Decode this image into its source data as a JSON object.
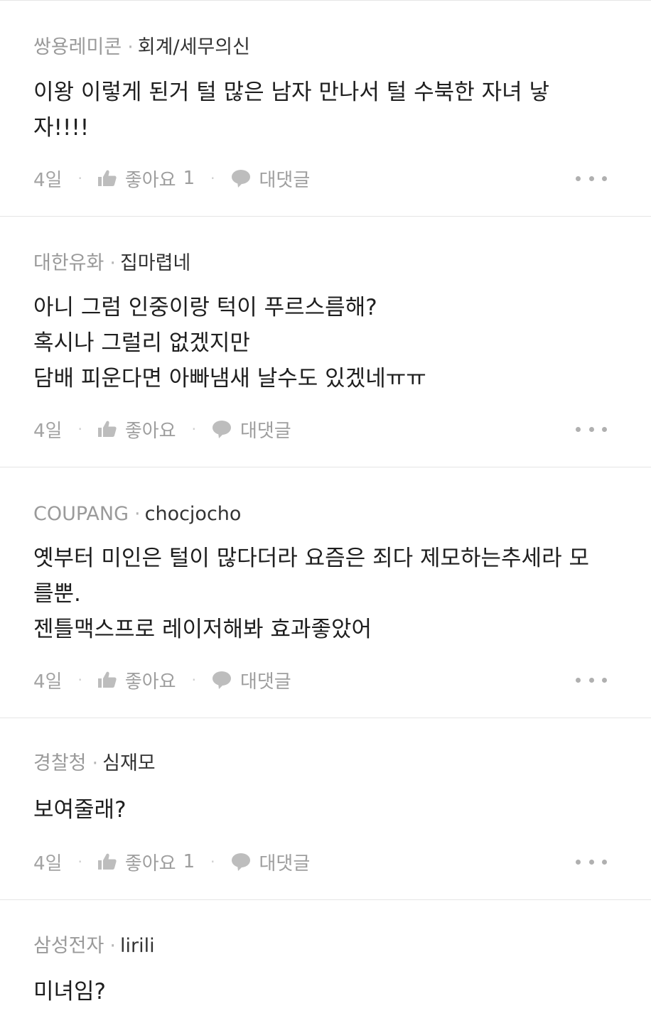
{
  "comments": [
    {
      "company": "쌍용레미콘",
      "nickname": "회계/세무의신",
      "lines": [
        "이왕 이렇게 된거 털 많은 남자 만나서 털 수북한 자녀 낳",
        "자!!!!"
      ],
      "time": "4일",
      "like_label": "좋아요",
      "like_count": "1",
      "reply_label": "대댓글"
    },
    {
      "company": "대한유화",
      "nickname": "집마렵네",
      "lines": [
        "아니 그럼 인중이랑 턱이 푸르스름해?",
        "혹시나 그럴리 없겠지만",
        "담배 피운다면 아빠냄새 날수도 있겠네ㅠㅠ"
      ],
      "time": "4일",
      "like_label": "좋아요",
      "like_count": "",
      "reply_label": "대댓글"
    },
    {
      "company": "COUPANG",
      "nickname": "chocjocho",
      "lines": [
        "옛부터 미인은 털이 많다더라 요즘은 죄다 제모하는추세라 모",
        "를뿐.",
        "젠틀맥스프로 레이저해봐 효과좋았어"
      ],
      "time": "4일",
      "like_label": "좋아요",
      "like_count": "",
      "reply_label": "대댓글"
    },
    {
      "company": "경찰청",
      "nickname": "심재모",
      "lines": [
        "보여줄래?"
      ],
      "time": "4일",
      "like_label": "좋아요",
      "like_count": "1",
      "reply_label": "대댓글"
    },
    {
      "company": "삼성전자",
      "nickname": "lirili",
      "lines": [
        "미녀임?"
      ],
      "time": "",
      "like_label": "",
      "like_count": "",
      "reply_label": ""
    }
  ],
  "separator": "·",
  "icons": {
    "like": "thumbs-up-icon",
    "reply": "speech-bubble-icon",
    "more": "more-dots-icon"
  },
  "colors": {
    "meta_company": "#9a9a9a",
    "meta_nick": "#333333",
    "body_text": "#1e1e1e",
    "action_text": "#9e9e9e",
    "divider": "#e5e5e5"
  }
}
